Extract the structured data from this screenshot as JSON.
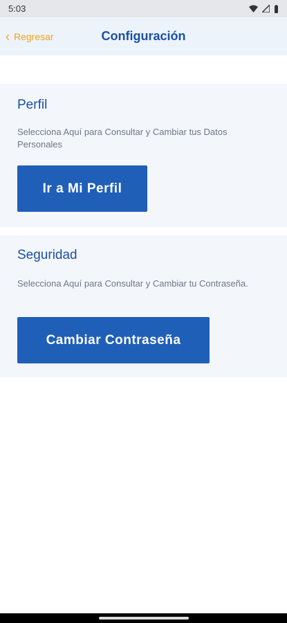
{
  "status_bar": {
    "time": "5:03"
  },
  "header": {
    "back_label": "Regresar",
    "title": "Configuración"
  },
  "perfil": {
    "heading": "Perfil",
    "description": "Selecciona Aquí para Consultar y Cambiar tus Datos Personales",
    "button_label": "Ir a Mi Perfil"
  },
  "seguridad": {
    "heading": "Seguridad",
    "description": "Selecciona Aquí para Consultar y Cambiar tu Contraseña.",
    "button_label": "Cambiar Contraseña"
  },
  "colors": {
    "accent": "#1f5fb8",
    "back": "#f2a316",
    "title": "#1a4fa6"
  }
}
